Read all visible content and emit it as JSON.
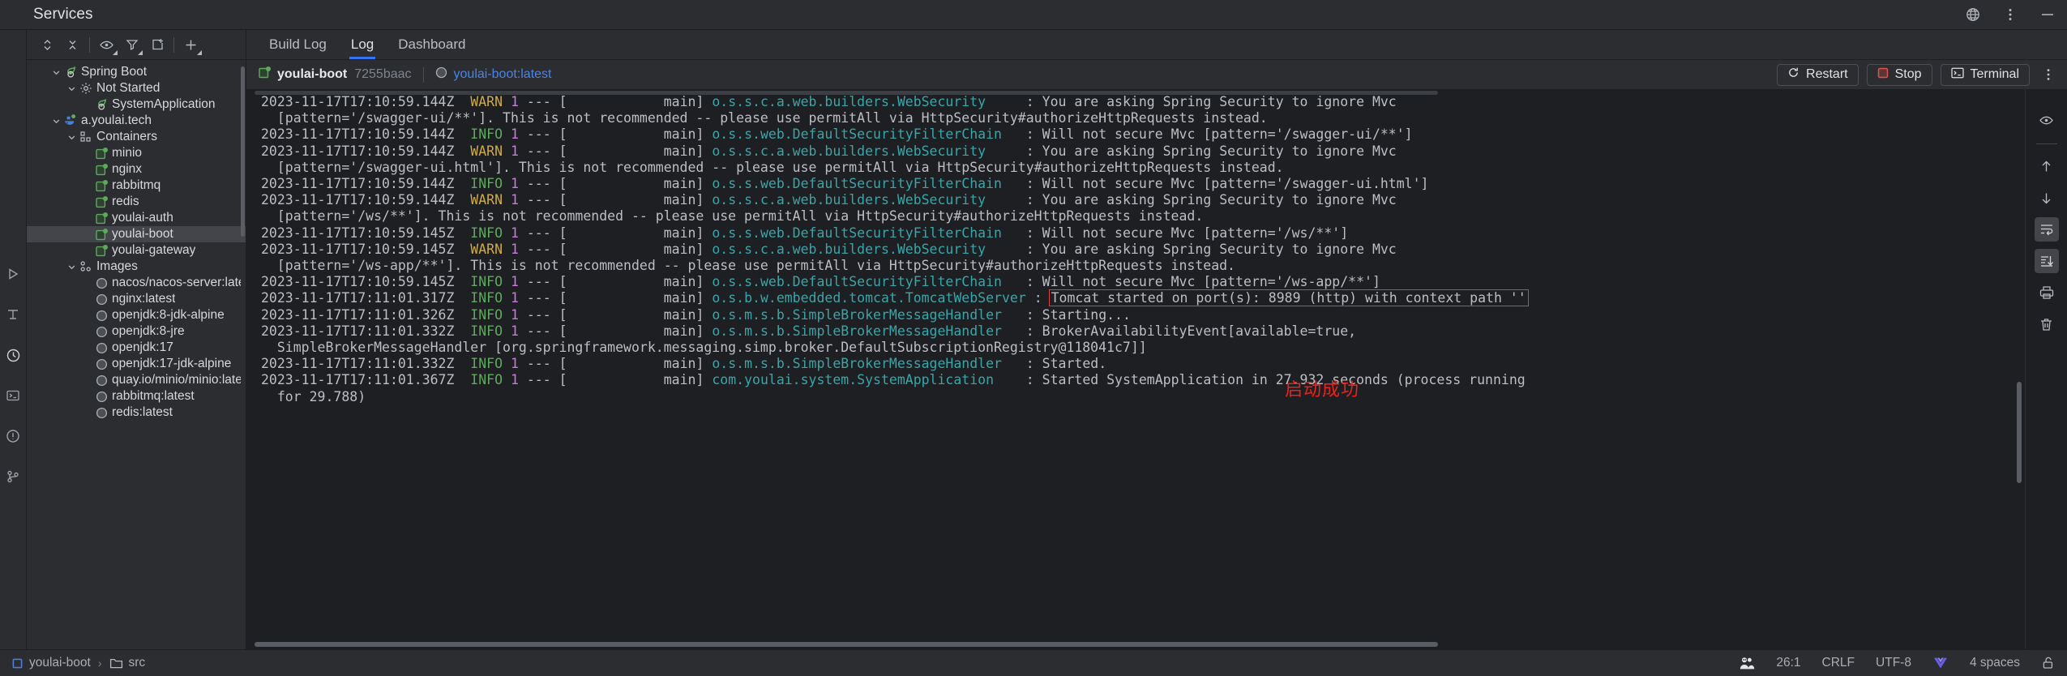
{
  "window": {
    "title": "Services",
    "right_icons": [
      "globe-icon",
      "kebab-menu-icon",
      "minimize-icon"
    ]
  },
  "sidebar": {
    "toolbar_icons": [
      "expand-collapse-icon",
      "collapse-all-icon",
      "eye-filter-icon",
      "filter-icon",
      "add-tab-icon",
      "plus-icon"
    ],
    "tree": [
      {
        "label": "Spring Boot",
        "indent": 0,
        "chevron": "down",
        "icon": "spring-boot-icon",
        "selected": false
      },
      {
        "label": "Not Started",
        "indent": 1,
        "chevron": "down",
        "icon": "gear-icon",
        "selected": false
      },
      {
        "label": "SystemApplication",
        "indent": 2,
        "chevron": "none",
        "icon": "spring-boot-icon",
        "selected": false
      },
      {
        "label": "a.youlai.tech",
        "indent": 0,
        "chevron": "down",
        "icon": "docker-icon",
        "selected": false
      },
      {
        "label": "Containers",
        "indent": 1,
        "chevron": "down",
        "icon": "containers-icon",
        "selected": false
      },
      {
        "label": "minio",
        "indent": 2,
        "chevron": "none",
        "icon": "container-running-icon",
        "selected": false
      },
      {
        "label": "nginx",
        "indent": 2,
        "chevron": "none",
        "icon": "container-running-icon",
        "selected": false
      },
      {
        "label": "rabbitmq",
        "indent": 2,
        "chevron": "none",
        "icon": "container-running-icon",
        "selected": false
      },
      {
        "label": "redis",
        "indent": 2,
        "chevron": "none",
        "icon": "container-running-icon",
        "selected": false
      },
      {
        "label": "youlai-auth",
        "indent": 2,
        "chevron": "none",
        "icon": "container-running-icon",
        "selected": false
      },
      {
        "label": "youlai-boot",
        "indent": 2,
        "chevron": "none",
        "icon": "container-running-icon",
        "selected": true
      },
      {
        "label": "youlai-gateway",
        "indent": 2,
        "chevron": "none",
        "icon": "container-running-icon",
        "selected": false
      },
      {
        "label": "Images",
        "indent": 1,
        "chevron": "down",
        "icon": "images-icon",
        "selected": false
      },
      {
        "label": "nacos/nacos-server:latest",
        "indent": 2,
        "chevron": "none",
        "icon": "image-icon",
        "selected": false
      },
      {
        "label": "nginx:latest",
        "indent": 2,
        "chevron": "none",
        "icon": "image-icon",
        "selected": false
      },
      {
        "label": "openjdk:8-jdk-alpine",
        "indent": 2,
        "chevron": "none",
        "icon": "image-icon",
        "selected": false
      },
      {
        "label": "openjdk:8-jre",
        "indent": 2,
        "chevron": "none",
        "icon": "image-icon",
        "selected": false
      },
      {
        "label": "openjdk:17",
        "indent": 2,
        "chevron": "none",
        "icon": "image-icon",
        "selected": false
      },
      {
        "label": "openjdk:17-jdk-alpine",
        "indent": 2,
        "chevron": "none",
        "icon": "image-icon",
        "selected": false
      },
      {
        "label": "quay.io/minio/minio:latest",
        "indent": 2,
        "chevron": "none",
        "icon": "image-icon",
        "selected": false
      },
      {
        "label": "rabbitmq:latest",
        "indent": 2,
        "chevron": "none",
        "icon": "image-icon",
        "selected": false
      },
      {
        "label": "redis:latest",
        "indent": 2,
        "chevron": "none",
        "icon": "image-icon",
        "selected": false
      }
    ]
  },
  "leftstrip": {
    "icons": [
      "run-icon",
      "structure-icon",
      "services-icon",
      "terminal-icon",
      "problems-icon",
      "git-icon"
    ]
  },
  "main": {
    "tabs": [
      {
        "label": "Build Log",
        "active": false
      },
      {
        "label": "Log",
        "active": true
      },
      {
        "label": "Dashboard",
        "active": false
      }
    ],
    "runbar": {
      "container_name": "youlai-boot",
      "container_hash": "7255baac",
      "image_name": "youlai-boot:latest",
      "restart_label": "Restart",
      "stop_label": "Stop",
      "terminal_label": "Terminal"
    },
    "right_rail_icons": [
      "eye-soft-wrap-icon",
      "arrow-up-icon",
      "arrow-down-icon",
      "soft-wrap-icon",
      "scroll-to-end-icon",
      "print-icon",
      "trash-icon"
    ]
  },
  "log": {
    "annotation_cn": "启动成功",
    "highlight_color": "#e03d3d",
    "lines": [
      {
        "ts": "2023-11-17T17:10:59.144Z",
        "level": "WARN",
        "pid": "1",
        "thread": "main",
        "logger": "o.s.s.c.a.web.builders.WebSecurity",
        "msg": "You are asking Spring Security to ignore Mvc"
      },
      {
        "cont": "  [pattern='/swagger-ui/**']. This is not recommended -- please use permitAll via HttpSecurity#authorizeHttpRequests instead."
      },
      {
        "ts": "2023-11-17T17:10:59.144Z",
        "level": "INFO",
        "pid": "1",
        "thread": "main",
        "logger": "o.s.s.web.DefaultSecurityFilterChain",
        "msg": "Will not secure Mvc [pattern='/swagger-ui/**']"
      },
      {
        "ts": "2023-11-17T17:10:59.144Z",
        "level": "WARN",
        "pid": "1",
        "thread": "main",
        "logger": "o.s.s.c.a.web.builders.WebSecurity",
        "msg": "You are asking Spring Security to ignore Mvc"
      },
      {
        "cont": "  [pattern='/swagger-ui.html']. This is not recommended -- please use permitAll via HttpSecurity#authorizeHttpRequests instead."
      },
      {
        "ts": "2023-11-17T17:10:59.144Z",
        "level": "INFO",
        "pid": "1",
        "thread": "main",
        "logger": "o.s.s.web.DefaultSecurityFilterChain",
        "msg": "Will not secure Mvc [pattern='/swagger-ui.html']"
      },
      {
        "ts": "2023-11-17T17:10:59.144Z",
        "level": "WARN",
        "pid": "1",
        "thread": "main",
        "logger": "o.s.s.c.a.web.builders.WebSecurity",
        "msg": "You are asking Spring Security to ignore Mvc"
      },
      {
        "cont": "  [pattern='/ws/**']. This is not recommended -- please use permitAll via HttpSecurity#authorizeHttpRequests instead."
      },
      {
        "ts": "2023-11-17T17:10:59.145Z",
        "level": "INFO",
        "pid": "1",
        "thread": "main",
        "logger": "o.s.s.web.DefaultSecurityFilterChain",
        "msg": "Will not secure Mvc [pattern='/ws/**']"
      },
      {
        "ts": "2023-11-17T17:10:59.145Z",
        "level": "WARN",
        "pid": "1",
        "thread": "main",
        "logger": "o.s.s.c.a.web.builders.WebSecurity",
        "msg": "You are asking Spring Security to ignore Mvc"
      },
      {
        "cont": "  [pattern='/ws-app/**']. This is not recommended -- please use permitAll via HttpSecurity#authorizeHttpRequests instead."
      },
      {
        "ts": "2023-11-17T17:10:59.145Z",
        "level": "INFO",
        "pid": "1",
        "thread": "main",
        "logger": "o.s.s.web.DefaultSecurityFilterChain",
        "msg": "Will not secure Mvc [pattern='/ws-app/**']"
      },
      {
        "ts": "2023-11-17T17:11:01.317Z",
        "level": "INFO",
        "pid": "1",
        "thread": "main",
        "logger": "o.s.b.w.embedded.tomcat.TomcatWebServer",
        "msg": "Tomcat started on port(s): 8989 (http) with context path ''",
        "highlight": true
      },
      {
        "ts": "2023-11-17T17:11:01.326Z",
        "level": "INFO",
        "pid": "1",
        "thread": "main",
        "logger": "o.s.m.s.b.SimpleBrokerMessageHandler",
        "msg": "Starting..."
      },
      {
        "ts": "2023-11-17T17:11:01.332Z",
        "level": "INFO",
        "pid": "1",
        "thread": "main",
        "logger": "o.s.m.s.b.SimpleBrokerMessageHandler",
        "msg": "BrokerAvailabilityEvent[available=true,"
      },
      {
        "cont": "  SimpleBrokerMessageHandler [org.springframework.messaging.simp.broker.DefaultSubscriptionRegistry@118041c7]]"
      },
      {
        "ts": "2023-11-17T17:11:01.332Z",
        "level": "INFO",
        "pid": "1",
        "thread": "main",
        "logger": "o.s.m.s.b.SimpleBrokerMessageHandler",
        "msg": "Started."
      },
      {
        "ts": "2023-11-17T17:11:01.367Z",
        "level": "INFO",
        "pid": "1",
        "thread": "main",
        "logger": "com.youlai.system.SystemApplication",
        "msg": "Started SystemApplication in 27.932 seconds (process running"
      },
      {
        "cont": "  for 29.788)"
      }
    ]
  },
  "statusbar": {
    "breadcrumb": [
      {
        "label": "youlai-boot",
        "icon": "module-icon"
      },
      {
        "label": "src",
        "icon": "folder-icon"
      }
    ],
    "right": [
      {
        "type": "icon",
        "name": "codewithme-icon"
      },
      {
        "type": "text",
        "name": "caret-position",
        "label": "26:1"
      },
      {
        "type": "text",
        "name": "line-separator",
        "label": "CRLF"
      },
      {
        "type": "text",
        "name": "file-encoding",
        "label": "UTF-8"
      },
      {
        "type": "icon",
        "name": "vue-icon"
      },
      {
        "type": "text",
        "name": "indent-size",
        "label": "4 spaces"
      },
      {
        "type": "icon",
        "name": "unlock-icon"
      }
    ]
  }
}
